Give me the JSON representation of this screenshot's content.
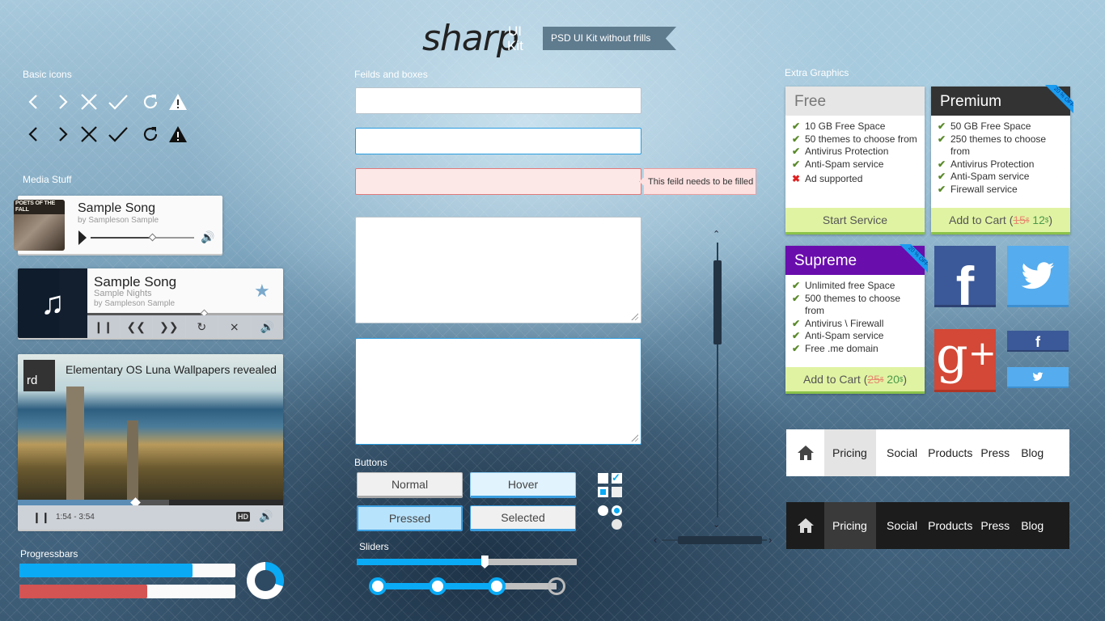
{
  "header": {
    "logo": "sharp",
    "logo_ui": "UI",
    "logo_kit": "Kit",
    "tagline": "PSD UI Kit without frills"
  },
  "sections": {
    "basic_icons": "Basic icons",
    "media": "Media Stuff",
    "progress": "Progressbars",
    "fields": "Feilds and boxes",
    "buttons": "Buttons",
    "sliders": "Sliders",
    "extra": "Extra Graphics"
  },
  "icons": [
    "chevron-left",
    "chevron-right",
    "close",
    "check",
    "refresh",
    "warning"
  ],
  "player1": {
    "title": "Sample Song",
    "artist": "by Sampleson Sample",
    "album_text": "POETS OF THE FALL",
    "progress": 0.6
  },
  "player2": {
    "title": "Sample Song",
    "album": "Sample Nights",
    "artist": "by Sampleson Sample",
    "progress": 0.6
  },
  "video": {
    "badge": "rd",
    "title": "Elementary OS Luna Wallpapers revealed",
    "time": "1:54 - 3:54",
    "hd": "HD",
    "progress": 0.45,
    "buffered": 0.57
  },
  "progressbars": {
    "blue": 0.8,
    "red": 0.59,
    "ring": 0.3,
    "colors": {
      "blue": "#0aaaf5",
      "red": "#d45353"
    }
  },
  "fields": {
    "error_tip": "This feild needs to be filled"
  },
  "buttons": {
    "normal": "Normal",
    "hover": "Hover",
    "pressed": "Pressed",
    "selected": "Selected"
  },
  "sliders": {
    "value": 0.58,
    "steps": 4,
    "step_value": 3
  },
  "pricing": [
    {
      "name": "Free",
      "features": [
        [
          "10 GB Free Space",
          true
        ],
        [
          "50 themes to choose from",
          true
        ],
        [
          "Antivirus Protection",
          true
        ],
        [
          "Anti-Spam service",
          true
        ],
        [
          "Ad supported",
          false
        ]
      ],
      "cta": "Start Service",
      "header_color": "#e6e6e6"
    },
    {
      "name": "Premium",
      "badge": "20 % OFF !",
      "features": [
        [
          "50 GB Free Space",
          true
        ],
        [
          "250 themes to choose from",
          true
        ],
        [
          "Antivirus Protection",
          true
        ],
        [
          "Anti-Spam service",
          true
        ],
        [
          "Firewall service",
          true
        ]
      ],
      "cta": "Add to Cart (",
      "old_price": "15",
      "new_price": "12",
      "currency": "$",
      "cta_end": ")",
      "header_color": "#333333"
    },
    {
      "name": "Supreme",
      "badge": "20 % OFF !",
      "features": [
        [
          "Unlimited free Space",
          true
        ],
        [
          "500 themes to choose from",
          true
        ],
        [
          "Antivirus \\ Firewall",
          true
        ],
        [
          "Anti-Spam service",
          true
        ],
        [
          "Free .me domain",
          true
        ]
      ],
      "cta": "Add to Cart (",
      "old_price": "25",
      "new_price": "20",
      "currency": "$",
      "cta_end": ")",
      "header_color": "#6a0dad"
    }
  ],
  "social": {
    "facebook": "f",
    "colors": {
      "facebook": "#3b5998",
      "twitter": "#55acee",
      "gplus": "#d34836"
    }
  },
  "nav": {
    "items": [
      "Pricing",
      "Social",
      "Products",
      "Press",
      "Blog"
    ],
    "active": "Pricing"
  }
}
